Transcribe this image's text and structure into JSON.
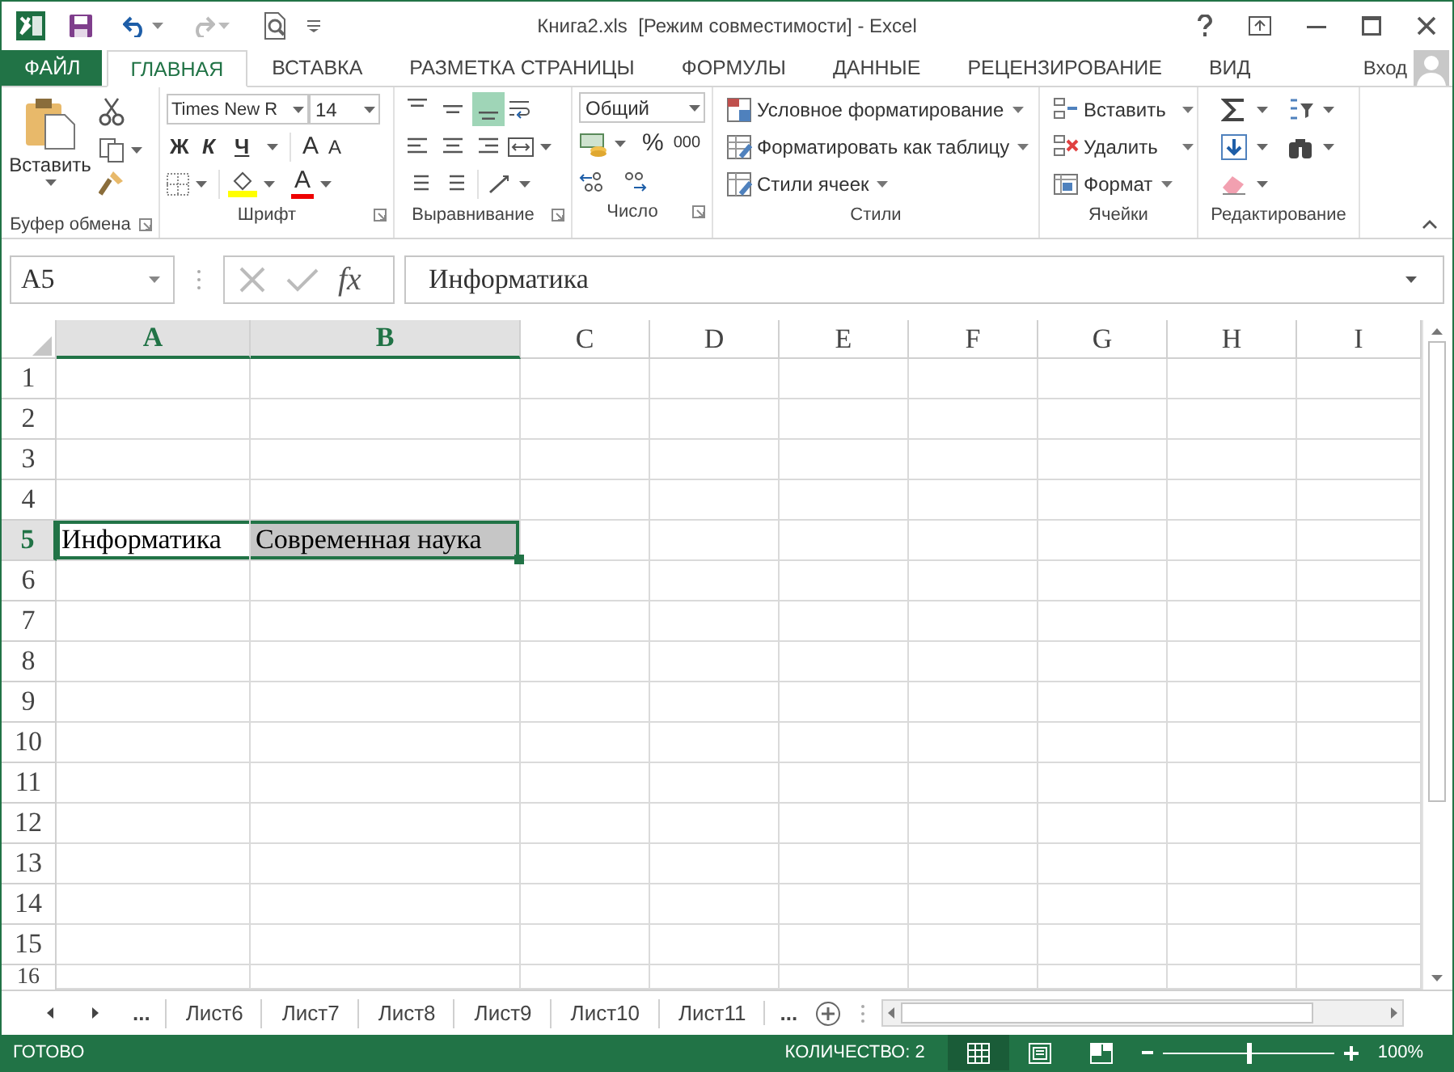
{
  "window": {
    "title": "Книга2.xls  [Режим совместимости] - Excel"
  },
  "ribbon_tabs": [
    {
      "label": "ФАЙЛ",
      "kind": "file",
      "selected": false
    },
    {
      "label": "ГЛАВНАЯ",
      "kind": "tab",
      "selected": true
    },
    {
      "label": "ВСТАВКА",
      "kind": "tab",
      "selected": false
    },
    {
      "label": "РАЗМЕТКА СТРАНИЦЫ",
      "kind": "tab",
      "selected": false
    },
    {
      "label": "ФОРМУЛЫ",
      "kind": "tab",
      "selected": false
    },
    {
      "label": "ДАННЫЕ",
      "kind": "tab",
      "selected": false
    },
    {
      "label": "РЕЦЕНЗИРОВАНИЕ",
      "kind": "tab",
      "selected": false
    },
    {
      "label": "ВИД",
      "kind": "tab",
      "selected": false
    }
  ],
  "account": {
    "label": "Вход"
  },
  "ribbon": {
    "clipboard": {
      "title": "Буфер обмена",
      "paste": "Вставить"
    },
    "font": {
      "title": "Шрифт",
      "font_name": "Times New R",
      "font_size": "14",
      "bold": "Ж",
      "italic": "К",
      "underline": "Ч",
      "grow": "A",
      "shrink": "A",
      "font_color": "A"
    },
    "alignment": {
      "title": "Выравнивание",
      "vertical": [
        {
          "kind": "top",
          "selected": false
        },
        {
          "kind": "middle",
          "selected": false
        },
        {
          "kind": "bottom",
          "selected": true
        }
      ]
    },
    "number": {
      "title": "Число",
      "format": "Общий",
      "percent": "%",
      "thousands": "000"
    },
    "styles": {
      "title": "Стили",
      "items": [
        {
          "kind": "conditional",
          "label": "Условное форматирование"
        },
        {
          "kind": "table",
          "label": "Форматировать как таблицу"
        },
        {
          "kind": "cell_styles",
          "label": "Стили ячеек"
        }
      ]
    },
    "cells": {
      "title": "Ячейки",
      "items": [
        {
          "kind": "insert",
          "label": "Вставить"
        },
        {
          "kind": "delete",
          "label": "Удалить"
        },
        {
          "kind": "format",
          "label": "Формат"
        }
      ]
    },
    "editing": {
      "title": "Редактирование"
    }
  },
  "formula_bar": {
    "name_box": "A5",
    "function_label": "fx",
    "value": "Информатика"
  },
  "sheet": {
    "columns": [
      {
        "label": "A",
        "selected": true
      },
      {
        "label": "B",
        "selected": true
      },
      {
        "label": "C",
        "selected": false
      },
      {
        "label": "D",
        "selected": false
      },
      {
        "label": "E",
        "selected": false
      },
      {
        "label": "F",
        "selected": false
      },
      {
        "label": "G",
        "selected": false
      },
      {
        "label": "H",
        "selected": false
      },
      {
        "label": "I",
        "selected": false
      }
    ],
    "rows": [
      {
        "label": "1",
        "selected": false,
        "cells": []
      },
      {
        "label": "2",
        "selected": false,
        "cells": []
      },
      {
        "label": "3",
        "selected": false,
        "cells": []
      },
      {
        "label": "4",
        "selected": false,
        "cells": []
      },
      {
        "label": "5",
        "selected": true,
        "cells": [
          {
            "text": "Информатика",
            "selected": true,
            "active": true
          },
          {
            "text": "Современная наука",
            "selected": true,
            "active": false
          }
        ]
      },
      {
        "label": "6",
        "selected": false,
        "cells": []
      },
      {
        "label": "7",
        "selected": false,
        "cells": []
      },
      {
        "label": "8",
        "selected": false,
        "cells": []
      },
      {
        "label": "9",
        "selected": false,
        "cells": []
      },
      {
        "label": "10",
        "selected": false,
        "cells": []
      },
      {
        "label": "11",
        "selected": false,
        "cells": []
      },
      {
        "label": "12",
        "selected": false,
        "cells": []
      },
      {
        "label": "13",
        "selected": false,
        "cells": []
      },
      {
        "label": "14",
        "selected": false,
        "cells": []
      },
      {
        "label": "15",
        "selected": false,
        "cells": []
      },
      {
        "label": "16",
        "selected": false,
        "cells": []
      }
    ]
  },
  "sheet_tabs": {
    "more_left": "...",
    "items": [
      {
        "label": "Лист6",
        "selected": false
      },
      {
        "label": "Лист7",
        "selected": false
      },
      {
        "label": "Лист8",
        "selected": false
      },
      {
        "label": "Лист9",
        "selected": false
      },
      {
        "label": "Лист10",
        "selected": false
      },
      {
        "label": "Лист11",
        "selected": false
      }
    ],
    "more_right": "..."
  },
  "status_bar": {
    "status": "ГОТОВО",
    "summary": "КОЛИЧЕСТВО: 2",
    "views": [
      {
        "kind": "normal",
        "selected": true
      },
      {
        "kind": "page_layout",
        "selected": false
      },
      {
        "kind": "page_break",
        "selected": false
      }
    ],
    "zoom": {
      "level": 0.5,
      "reading": "100%"
    }
  }
}
